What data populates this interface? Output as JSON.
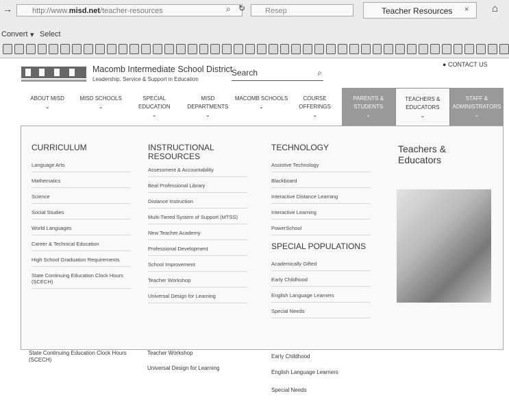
{
  "browser": {
    "url_prefix": "http://www.",
    "url_domain": "misd.net",
    "url_suffix": "/teacher-resources",
    "search_placeholder": "Resep",
    "tab_title": "Teacher Resources",
    "convert": "Convert",
    "select": "Select"
  },
  "site": {
    "district": "Macomb Intermediate School District",
    "tagline": "Leadership, Service & Support in Education",
    "search_placeholder": "Search",
    "contact": "CONTACT US"
  },
  "nav": [
    {
      "label": "ABOUT MISD"
    },
    {
      "label": "MISD SCHOOLS"
    },
    {
      "label": "SPECIAL EDUCATION"
    },
    {
      "label": "MISD DEPARTMENTS"
    },
    {
      "label": "MACOMB SCHOOLS"
    },
    {
      "label": "COURSE OFFERINGS"
    },
    {
      "label": "PARENTS & STUDENTS"
    },
    {
      "label": "TEACHERS & EDUCATORS"
    },
    {
      "label": "STAFF & ADMINISTRATORS"
    }
  ],
  "dropdown": {
    "curriculum": {
      "heading": "CURRICULUM",
      "links": [
        "Language Arts",
        "Mathematics",
        "Science",
        "Social Studies",
        "World Languages",
        "Career & Technical Education",
        "High School Graduation Requirements",
        "State Continuing Education Clock Hours (SCECH)"
      ]
    },
    "instructional": {
      "heading": "INSTRUCTIONAL RESOURCES",
      "links": [
        "Assessment & Accountability",
        "Beal Professional Library",
        "Distance Instruction",
        "Multi-Tiered System of Support (MTSS)",
        "New Teacher Academy",
        "Professional Development",
        "School Improvement",
        "Teacher Workshop",
        "Universal Design for Learning"
      ]
    },
    "technology": {
      "heading": "TECHNOLOGY",
      "links": [
        "Assistive Technology",
        "Blackboard",
        "Interactive Distance Learning",
        "Interactive Learning",
        "PowerSchool"
      ]
    },
    "special": {
      "heading": "SPECIAL POPULATIONS",
      "links": [
        "Academically Gifted",
        "Early Childhood",
        "English Language Learners",
        "Special Needs"
      ]
    },
    "featured": "Teachers & Educators"
  },
  "echo": {
    "col1": "State Continuing Education Clock Hours (SCECH)",
    "col2a": "Teacher Workshop",
    "col2b": "Universal Design for Learning",
    "col3a": "Early Childhood",
    "col3b": "English Language Learners",
    "col3c": "Special Needs"
  }
}
